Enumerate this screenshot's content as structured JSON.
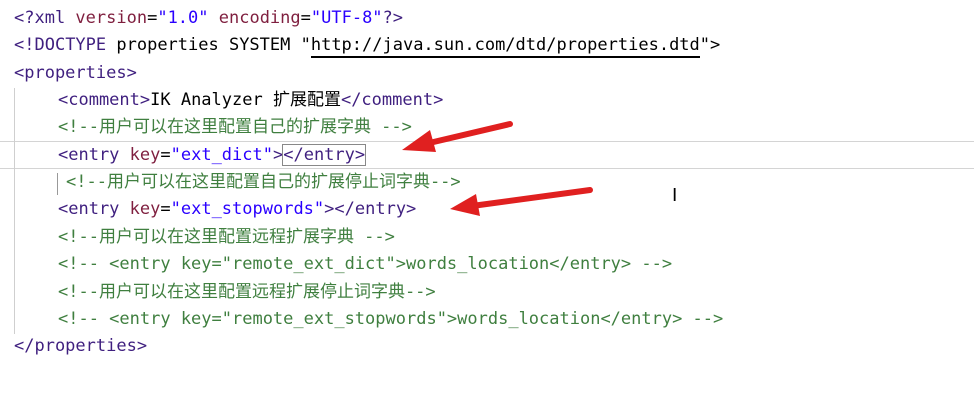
{
  "editor": {
    "lines": [
      {
        "p1": "<?xml ",
        "a1": "version",
        "e1": "=",
        "v1": "\"1.0\"",
        "a2": " encoding",
        "e2": "=",
        "v2": "\"UTF-8\"",
        "p2": "?>"
      },
      {
        "p1": "<!",
        "kw": "DOCTYPE",
        "p2": " properties SYSTEM \"",
        "url": "http://java.sun.com/dtd/properties.dtd",
        "p3": "\">"
      },
      {
        "open": "<properties>"
      },
      {
        "open": "<comment>",
        "text": "IK Analyzer 扩展配置",
        "close": "</comment>"
      },
      {
        "comment": "<!--用户可以在这里配置自己的扩展字典 -->"
      },
      {
        "o": "<entry ",
        "attr": "key",
        "eq": "=",
        "val": "\"ext_dict\"",
        "gt": ">",
        "close": "</entry>"
      },
      {
        "comment": "<!--用户可以在这里配置自己的扩展停止词字典-->"
      },
      {
        "o": "<entry ",
        "attr": "key",
        "eq": "=",
        "val": "\"ext_stopwords\"",
        "gt": ">",
        "close": "</entry>"
      },
      {
        "comment": "<!--用户可以在这里配置远程扩展字典 -->"
      },
      {
        "comment": "<!-- <entry key=\"remote_ext_dict\">words_location</entry> -->"
      },
      {
        "comment": "<!--用户可以在这里配置远程扩展停止词字典-->"
      },
      {
        "comment": "<!-- <entry key=\"remote_ext_stopwords\">words_location</entry> -->"
      },
      {
        "close": "</properties>"
      }
    ]
  },
  "colors": {
    "tag": "#3f1f7f",
    "attribute": "#7f1f3f",
    "value": "#2a00ff",
    "comment": "#3f7f3f",
    "arrow": "#e02020"
  },
  "icons": {
    "cursor": "text-cursor-icon",
    "annotation": "red-arrow-icon"
  }
}
